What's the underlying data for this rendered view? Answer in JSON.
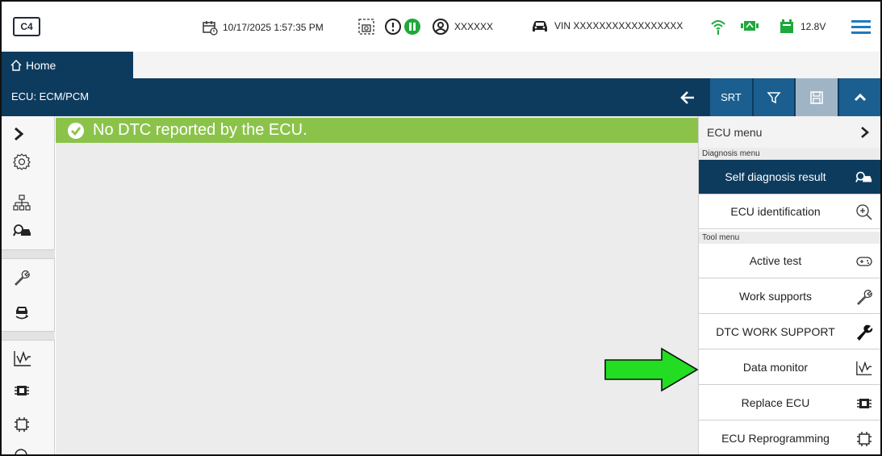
{
  "app": {
    "logo": "C4"
  },
  "status": {
    "datetime": "10/17/2025 1:57:35 PM",
    "user": "XXXXXX",
    "vin": "VIN XXXXXXXXXXXXXXXXX",
    "voltage": "12.8V"
  },
  "tabs": {
    "home_label": "Home"
  },
  "ecu": {
    "title": "ECU: ECM/PCM",
    "srt_label": "SRT"
  },
  "banner": {
    "text": "No DTC reported by the ECU."
  },
  "menu": {
    "header": "ECU menu",
    "diagnosis_section": "Diagnosis menu",
    "tool_section": "Tool menu",
    "items": [
      {
        "label": "Self diagnosis result",
        "icon": "car-search-icon"
      },
      {
        "label": "ECU identification",
        "icon": "zoom-in-icon"
      },
      {
        "label": "Active test",
        "icon": "gamepad-icon"
      },
      {
        "label": "Work supports",
        "icon": "wrench-outline-icon"
      },
      {
        "label": "DTC WORK SUPPORT",
        "icon": "wrench-solid-icon"
      },
      {
        "label": "Data monitor",
        "icon": "waveform-icon"
      },
      {
        "label": "Replace ECU",
        "icon": "chip-solid-icon"
      },
      {
        "label": "ECU Reprogramming",
        "icon": "chip-outline-icon"
      }
    ]
  },
  "colors": {
    "navy": "#0d3b5e",
    "banner_green": "#8bc34a",
    "arrow_green": "#22dd22",
    "status_green": "#1fa83c"
  }
}
